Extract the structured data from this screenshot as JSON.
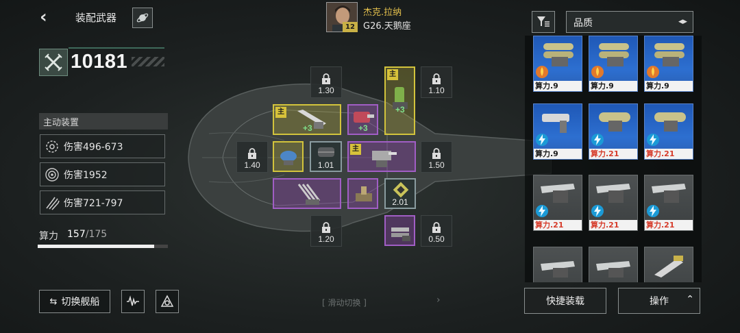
{
  "header": {
    "title": "装配武器",
    "pilot_name": "杰克.拉纳",
    "pilot_level": "12",
    "ship_name": "G26.天鹅座"
  },
  "power": {
    "value": "10181"
  },
  "active": {
    "heading": "主动装置",
    "devices": [
      {
        "label": "伤害496-673",
        "icon": "gear-ring-icon"
      },
      {
        "label": "伤害1952",
        "icon": "orb-icon"
      },
      {
        "label": "伤害721-797",
        "icon": "missiles-icon"
      }
    ]
  },
  "compute": {
    "label": "算力",
    "used": "157",
    "max": "/175",
    "fraction": 0.897
  },
  "bottom": {
    "switch_label": "切换舰船",
    "swipe_label": "[ 滑动切换 ]",
    "swipe_arrow": "›"
  },
  "slots": {
    "main_tag": "主",
    "lock_values": [
      "1.30",
      "1.10",
      "1.40",
      "1.50",
      "1.20",
      "0.50"
    ],
    "plus_values": [
      "+3",
      "+3",
      "+3"
    ],
    "weapon_values": [
      "1.01",
      "2.01"
    ]
  },
  "right": {
    "quality_label": "品质",
    "cards": [
      {
        "label": "算力.9",
        "red": false,
        "style": "blue"
      },
      {
        "label": "算力.9",
        "red": false,
        "style": "blue"
      },
      {
        "label": "算力.9",
        "red": false,
        "style": "blue"
      },
      {
        "label": "算力.9",
        "red": false,
        "style": "blue"
      },
      {
        "label": "算力.21",
        "red": true,
        "style": "blue"
      },
      {
        "label": "算力.21",
        "red": true,
        "style": "blue"
      },
      {
        "label": "算力.21",
        "red": true,
        "style": "grey"
      },
      {
        "label": "算力.21",
        "red": true,
        "style": "grey"
      },
      {
        "label": "算力.21",
        "red": true,
        "style": "grey"
      }
    ],
    "quick_equip_label": "快捷装载",
    "operate_label": "操作"
  },
  "colors": {
    "yellow": "#d3c43c",
    "purple": "#a15ec5",
    "blue_card": "#2d6fd0",
    "red_text": "#d63b2a"
  }
}
